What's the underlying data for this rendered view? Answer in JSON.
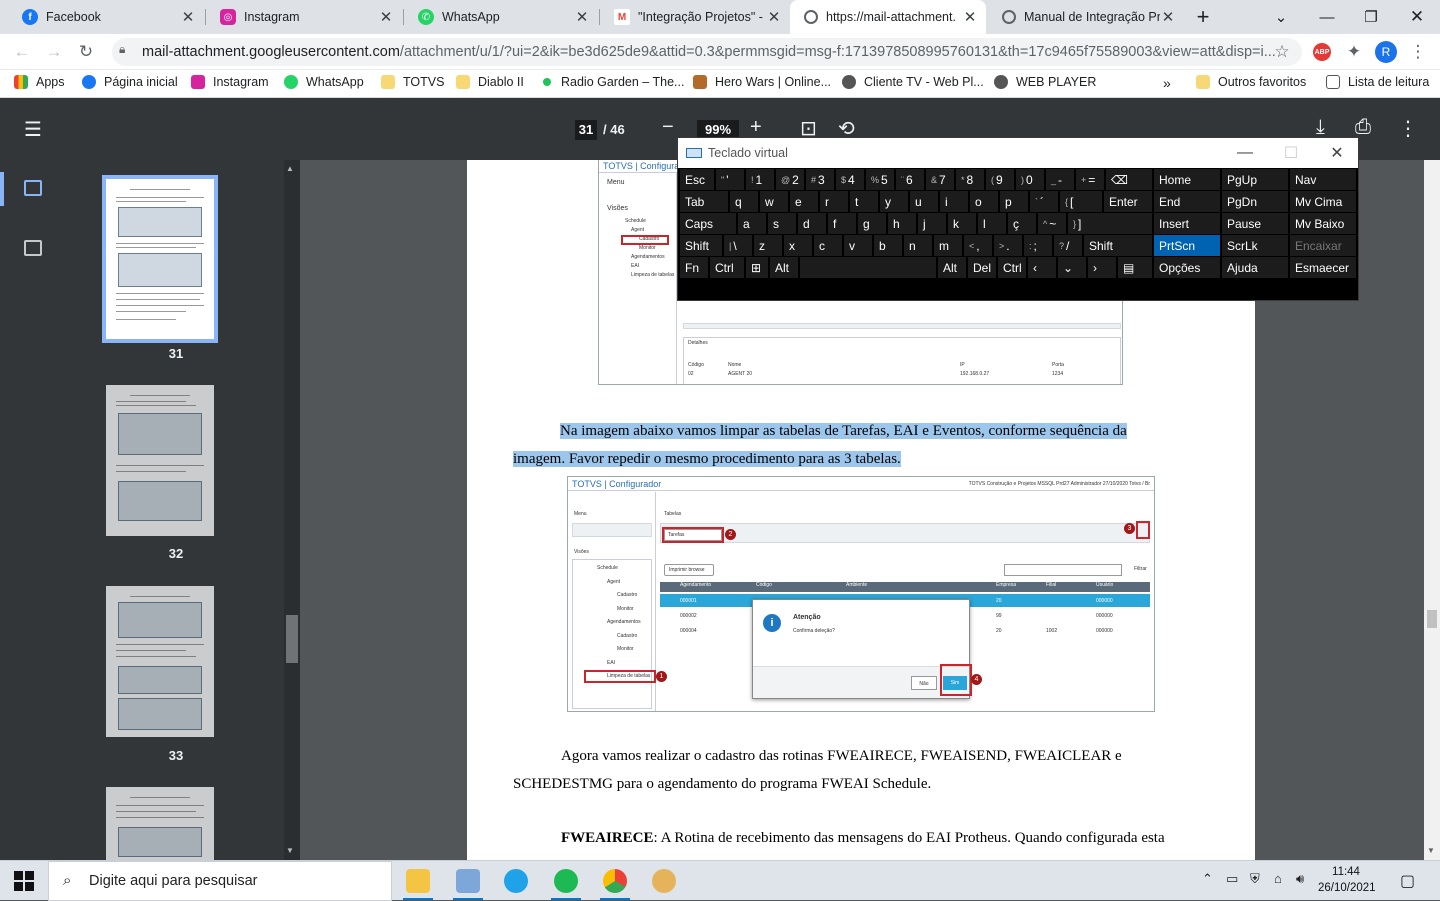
{
  "tabs": [
    {
      "title": "Facebook",
      "color": "#1877f2"
    },
    {
      "title": "Instagram",
      "color": "#d6249f"
    },
    {
      "title": "WhatsApp",
      "color": "#25d366"
    },
    {
      "title": "\"Integração Projetos\" - r",
      "color": "#ea4335"
    },
    {
      "title": "https://mail-attachment.",
      "color": "#5f6368"
    },
    {
      "title": "Manual de Integração Pr",
      "color": "#5f6368"
    }
  ],
  "url": {
    "host": "mail-attachment.googleusercontent.com",
    "path": "/attachment/u/1/?ui=2&ik=be3d625de9&attid=0.3&permmsgid=msg-f:1713978508995760131&th=17c9465f75589003&view=att&disp=i..."
  },
  "bookmarks": [
    {
      "label": "Apps"
    },
    {
      "label": "Página inicial"
    },
    {
      "label": "Instagram"
    },
    {
      "label": "WhatsApp"
    },
    {
      "label": "TOTVS"
    },
    {
      "label": "Diablo II"
    },
    {
      "label": "Radio Garden – The..."
    },
    {
      "label": "Hero Wars | Online..."
    },
    {
      "label": "Cliente TV - Web Pl..."
    },
    {
      "label": "WEB PLAYER"
    }
  ],
  "bookmarks_more": "»",
  "bookmarks_other": "Outros favoritos",
  "reading_list": "Lista de leitura",
  "profile_initial": "R",
  "abp": "ABP",
  "pdf": {
    "page": "31",
    "total": "/ 46",
    "zoom": "99%"
  },
  "thumbs": [
    "31",
    "32",
    "33"
  ],
  "doc": {
    "para1": "Na imagem abaixo vamos limpar as tabelas de Tarefas, EAI e Eventos, conforme sequência da",
    "para1b": "imagem. Favor repedir o mesmo procedimento para as 3 tabelas.",
    "para2": "Agora vamos realizar o cadastro das rotinas FWEAIRECE, FWEAISEND, FWEAICLEAR e",
    "para2b": "SCHEDESTMG para o agendamento do programa FWEAI Schedule.",
    "para3_bold": "FWEAIRECE",
    "para3": ": A Rotina de recebimento das mensagens do EAI Protheus. Quando configurada esta"
  },
  "shot": {
    "app_title": "TOTVS | Configurador",
    "top_app_title": "TOTVS | Configurador",
    "header_info": "TOTVS Construção e Projetos MSSQL Prd27     Administrador     27/10/2020     Totvs / Br",
    "menu": "Menu",
    "views": "Visões",
    "tables": "Tabelas",
    "tree": [
      "Schedule",
      "Agent",
      "Cadastro",
      "Monitor",
      "Agendamentos",
      "Cadastro",
      "Monitor",
      "EAI",
      "Limpeza de tabelas"
    ],
    "top_tree": [
      "Schedule",
      "Agent",
      "Cadastro",
      "Monitor",
      "Agendamentos",
      "EAI",
      "Limpeza de tabelas"
    ],
    "select_value": "Tarefas",
    "print_browse": "Imprimir browse",
    "filter": "Filtrar",
    "columns": [
      "Agendamento",
      "Código",
      "Ambiente",
      "Empresa",
      "Filial",
      "Usuário"
    ],
    "rows": [
      [
        "000001",
        "",
        "",
        "20",
        "",
        "000000"
      ],
      [
        "000002",
        "",
        "",
        "99",
        "",
        "000000"
      ],
      [
        "000004",
        "",
        "",
        "20",
        "1002",
        "000000"
      ]
    ],
    "dialog_title": "Atenção",
    "dialog_msg": "Confirma deleção?",
    "btn_no": "Não",
    "btn_yes": "Sim",
    "badges": [
      "1",
      "2",
      "3",
      "4"
    ],
    "details": "Detalhes",
    "det_cols": [
      "Código",
      "Nome",
      "IP",
      "Porta"
    ],
    "det_vals": [
      "02",
      "AGENT 20",
      "192.168.0.27",
      "1234"
    ]
  },
  "osk": {
    "title": "Teclado virtual",
    "rows": [
      [
        [
          "Esc",
          ""
        ],
        [
          "'",
          "\""
        ],
        [
          "1",
          "!"
        ],
        [
          "2",
          "@"
        ],
        [
          "3",
          "#"
        ],
        [
          "4",
          "$"
        ],
        [
          "5",
          "%"
        ],
        [
          "6",
          "¨"
        ],
        [
          "7",
          "&"
        ],
        [
          "8",
          "*"
        ],
        [
          "9",
          "("
        ],
        [
          "0",
          ")"
        ],
        [
          "-",
          "_"
        ],
        [
          "=",
          "+"
        ],
        [
          "⌫",
          ""
        ]
      ],
      [
        [
          "Tab",
          ""
        ],
        [
          "q",
          ""
        ],
        [
          "w",
          ""
        ],
        [
          "e",
          ""
        ],
        [
          "r",
          ""
        ],
        [
          "t",
          ""
        ],
        [
          "y",
          ""
        ],
        [
          "u",
          ""
        ],
        [
          "i",
          ""
        ],
        [
          "o",
          ""
        ],
        [
          "p",
          ""
        ],
        [
          "´",
          "`"
        ],
        [
          "[",
          "{"
        ],
        [
          "Enter",
          ""
        ]
      ],
      [
        [
          "Caps",
          ""
        ],
        [
          "a",
          ""
        ],
        [
          "s",
          ""
        ],
        [
          "d",
          ""
        ],
        [
          "f",
          ""
        ],
        [
          "g",
          ""
        ],
        [
          "h",
          ""
        ],
        [
          "j",
          ""
        ],
        [
          "k",
          ""
        ],
        [
          "l",
          ""
        ],
        [
          "ç",
          ""
        ],
        [
          "~",
          "^"
        ],
        [
          "]",
          "}"
        ]
      ],
      [
        [
          "Shift",
          ""
        ],
        [
          "\\",
          "|"
        ],
        [
          "z",
          ""
        ],
        [
          "x",
          ""
        ],
        [
          "c",
          ""
        ],
        [
          "v",
          ""
        ],
        [
          "b",
          ""
        ],
        [
          "n",
          ""
        ],
        [
          "m",
          ""
        ],
        [
          ",",
          "<"
        ],
        [
          ".",
          ">"
        ],
        [
          ";",
          ":"
        ],
        [
          "/",
          "?"
        ],
        [
          "Shift",
          ""
        ]
      ],
      [
        [
          "Fn",
          ""
        ],
        [
          "Ctrl",
          ""
        ],
        [
          "⊞",
          ""
        ],
        [
          "Alt",
          ""
        ],
        [
          "",
          ""
        ],
        [
          "Alt",
          ""
        ],
        [
          "Del",
          ""
        ],
        [
          "Ctrl",
          ""
        ],
        [
          "‹",
          ""
        ],
        [
          "⌄",
          ""
        ],
        [
          "›",
          ""
        ],
        [
          "▤",
          ""
        ]
      ]
    ],
    "side": [
      [
        "Home",
        "PgUp",
        "Nav"
      ],
      [
        "End",
        "PgDn",
        "Mv Cima"
      ],
      [
        "Insert",
        "Pause",
        "Mv Baixo"
      ],
      [
        "PrtScn",
        "ScrLk",
        "Encaixar"
      ],
      [
        "Opções",
        "Ajuda",
        "Esmaecer"
      ]
    ]
  },
  "taskbar": {
    "search": "Digite aqui para pesquisar",
    "time": "11:44",
    "date": "26/10/2021"
  }
}
